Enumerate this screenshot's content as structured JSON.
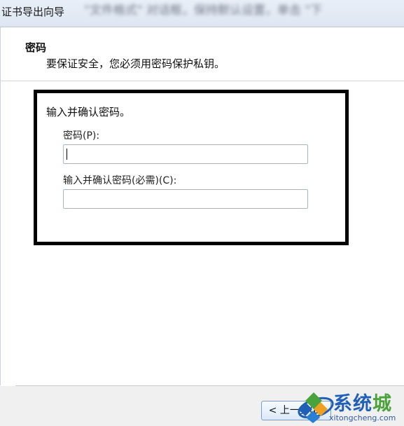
{
  "window": {
    "title": "证书导出向导",
    "title_blurred": "\"文件格式\" 对话框，保持默认设置，单击 \"下"
  },
  "header": {
    "section_title": "密码",
    "description": "要保证安全，您必须用密码保护私钥。"
  },
  "form": {
    "group_label": "输入并确认密码。",
    "password_label": "密码(P):",
    "password_value": "",
    "confirm_label": "输入并确认密码(必需)(C):",
    "confirm_value": ""
  },
  "footer": {
    "back_button_label": "< 上一步(B)"
  },
  "watermark": {
    "brand_part1": "系统",
    "brand_part2": "城",
    "url": "xitongcheng.com"
  },
  "colors": {
    "highlight_border": "#000000",
    "watermark_blue": "#1f5fb5",
    "watermark_green": "#4aa33a"
  }
}
